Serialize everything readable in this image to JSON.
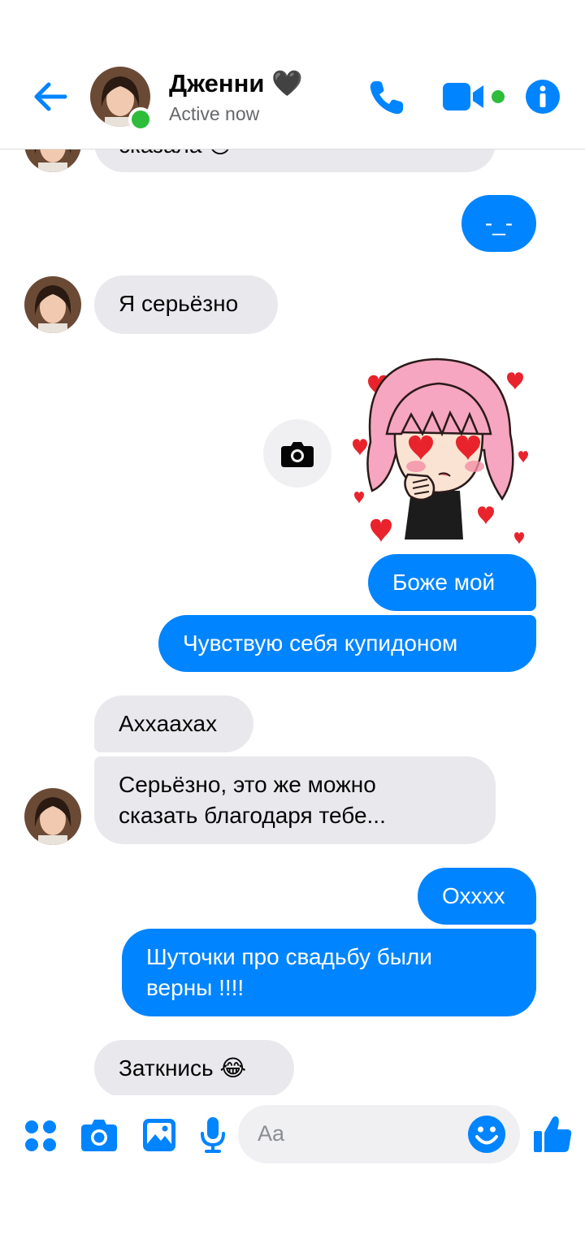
{
  "header": {
    "contact_name": "Дженни 🖤",
    "status": "Active now"
  },
  "messages": [
    {
      "from": "them",
      "text": "сказала 😢"
    },
    {
      "from": "me",
      "text": "-_-"
    },
    {
      "from": "them",
      "text": "Я серьёзно"
    },
    {
      "from": "me",
      "type": "sticker",
      "sticker": "pink-hair-girl-hearts-sticker"
    },
    {
      "from": "me",
      "text": "Боже мой"
    },
    {
      "from": "me",
      "text": "Чувствую себя купидоном"
    },
    {
      "from": "them",
      "text": "Ахxаахах"
    },
    {
      "from": "them",
      "text_line1": "Серьёзно, это же можно",
      "text_line2": "сказать благодаря тебе..."
    },
    {
      "from": "me",
      "text": "Охxxx"
    },
    {
      "from": "me",
      "text_line1": "Шуточки про свадьбу были",
      "text_line2": "верны !!!!"
    },
    {
      "from": "them",
      "text": "Заткнись 😂"
    }
  ],
  "composer": {
    "placeholder": "Aa"
  },
  "icons": {
    "header": [
      "back-arrow-icon",
      "phone-icon",
      "video-call-icon",
      "info-icon"
    ],
    "composer": [
      "apps-grid-icon",
      "camera-icon",
      "gallery-icon",
      "microphone-icon",
      "emoji-icon",
      "thumbs-up-icon"
    ]
  },
  "colors": {
    "accent": "#0084ff",
    "incoming_bubble": "#e9e8ec",
    "online": "#2dbd3a"
  }
}
